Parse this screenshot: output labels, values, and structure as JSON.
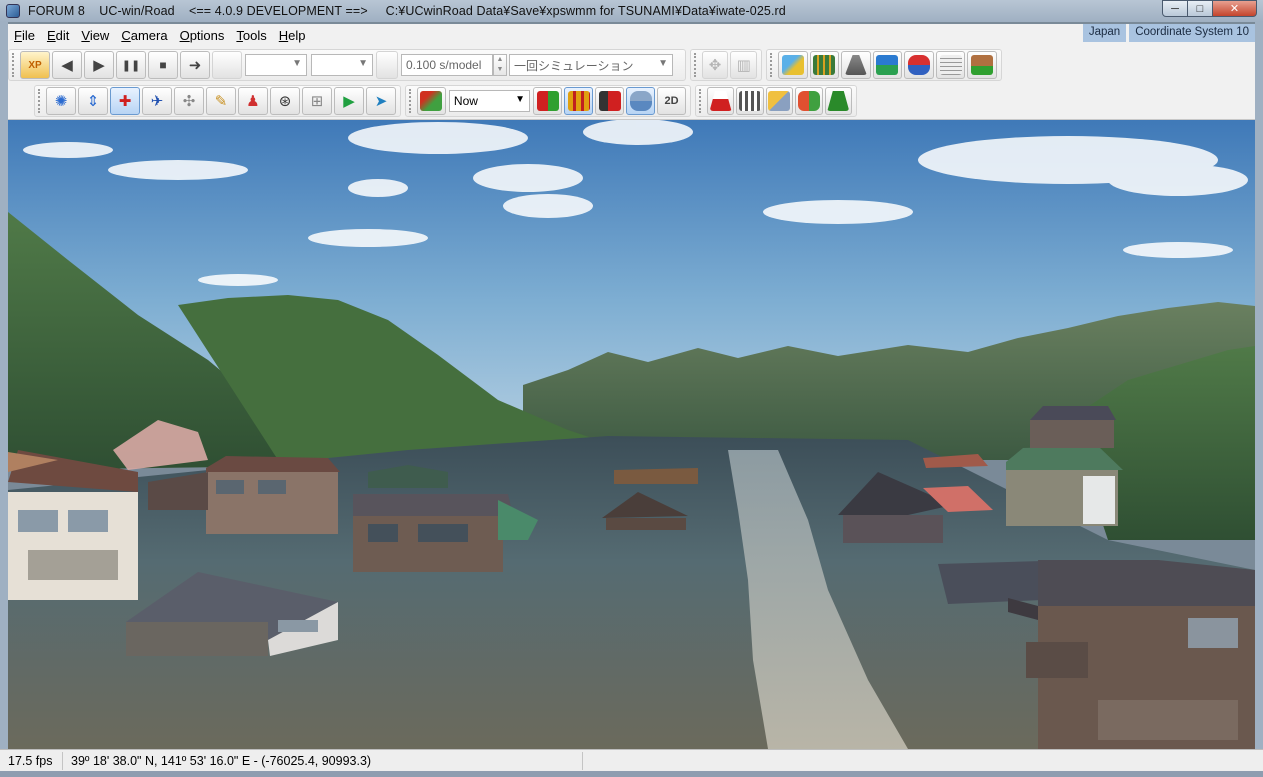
{
  "window": {
    "title": "FORUM 8    UC-win/Road    <== 4.0.9 DEVELOPMENT ==>     C:¥UCwinRoad Data¥Save¥xpswmm for TSUNAMI¥Data¥iwate-025.rd",
    "controls": {
      "minimize": "─",
      "maximize": "□",
      "close": "✕"
    }
  },
  "menu": {
    "items": [
      {
        "u": "F",
        "rest": "ile"
      },
      {
        "u": "E",
        "rest": "dit"
      },
      {
        "u": "V",
        "rest": "iew"
      },
      {
        "u": "C",
        "rest": "amera"
      },
      {
        "u": "O",
        "rest": "ptions"
      },
      {
        "u": "T",
        "rest": "ools"
      },
      {
        "u": "H",
        "rest": "elp"
      }
    ],
    "badges": [
      "Japan",
      "Coordinate System 10"
    ]
  },
  "toolbar1": {
    "xp_label": "XP",
    "time_step": "0.100 s/model",
    "simulation_mode": "一回シミュレーション",
    "spin_up": "▲",
    "spin_down": "▼"
  },
  "toolbar2": {
    "time_of_day": "Now",
    "view_2d": "2D"
  },
  "icons": {
    "back": "◀",
    "play": "▶",
    "pause": "❚❚",
    "stop": "■",
    "forward": "➜",
    "dropdown": "▼"
  },
  "status": {
    "fps": "17.5 fps",
    "coords": "39º 18' 38.0\" N, 141º 53' 16.0\" E  -  (-76025.4, 90993.3)"
  },
  "colors": {
    "sky_top": "#3f79b8",
    "sky_horizon": "#b6d0e2",
    "water": "#4a5f66",
    "mountain": "#3f6a3a"
  }
}
